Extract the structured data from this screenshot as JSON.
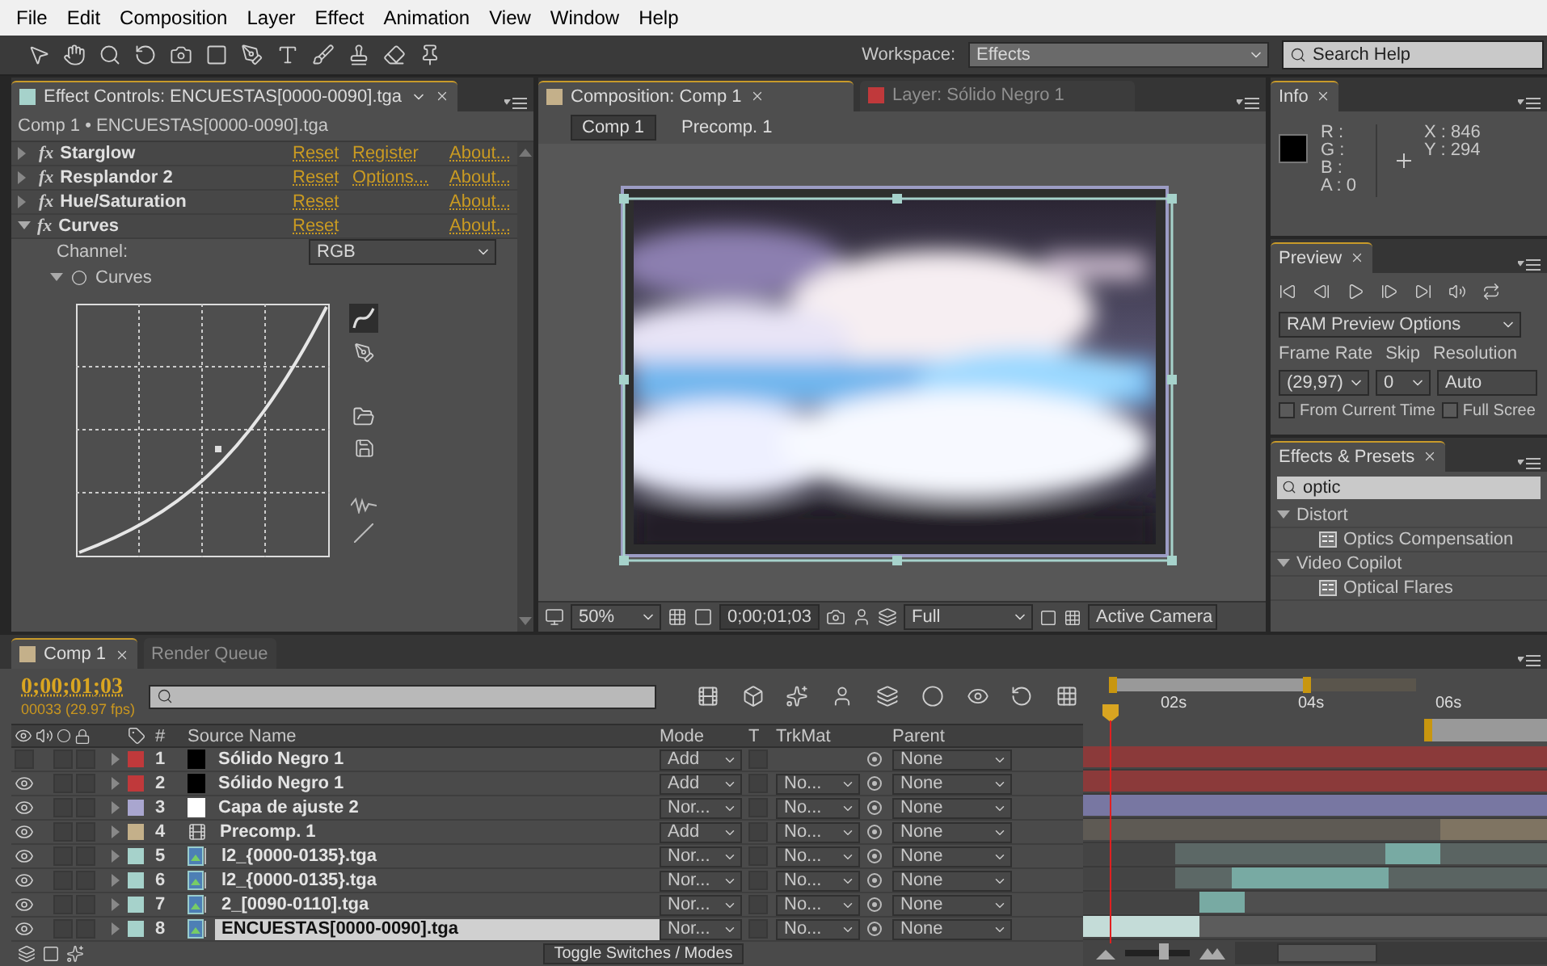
{
  "menu": [
    "File",
    "Edit",
    "Composition",
    "Layer",
    "Effect",
    "Animation",
    "View",
    "Window",
    "Help"
  ],
  "toolbar": {
    "workspace_label": "Workspace:",
    "workspace": "Effects",
    "search_placeholder": "Search Help"
  },
  "effect_controls": {
    "tab": "Effect Controls: ENCUESTAS[0000-0090].tga",
    "breadcrumb": "Comp 1 • ENCUESTAS[0000-0090].tga",
    "effects": [
      {
        "name": "Starglow",
        "fx": "fx",
        "expanded": false,
        "reset": "Reset",
        "extra": "Register",
        "about": "About..."
      },
      {
        "name": "Resplandor 2",
        "fx": "fx",
        "expanded": false,
        "reset": "Reset",
        "extra": "Options...",
        "about": "About..."
      },
      {
        "name": "Hue/Saturation",
        "fx": "fx",
        "expanded": false,
        "reset": "Reset",
        "about": "About..."
      },
      {
        "name": "Curves",
        "fx": "fx",
        "expanded": true,
        "reset": "Reset",
        "about": "About..."
      }
    ],
    "channel_label": "Channel:",
    "channel": "RGB",
    "curves_label": "Curves"
  },
  "composition": {
    "tabs": [
      {
        "label": "Composition: Comp 1",
        "selected": true
      },
      {
        "label": "Layer: Sólido Negro 1",
        "selected": false
      }
    ],
    "breadcrumbs": [
      {
        "label": "Comp 1",
        "selected": true
      },
      {
        "label": "Precomp. 1",
        "selected": false
      }
    ],
    "zoom": "50%",
    "timecode": "0;00;01;03",
    "quality": "Full",
    "camera": "Active Camera"
  },
  "info": {
    "tab": "Info",
    "swatch": {
      "color": "#000000"
    },
    "channels": [
      "R :",
      "G :",
      "B :",
      "A : 0"
    ],
    "x": "X : 846",
    "y": "Y : 294"
  },
  "preview": {
    "tab": "Preview",
    "ram_options": "RAM Preview Options",
    "frame_rate_label": "Frame Rate",
    "skip_label": "Skip",
    "resolution_label": "Resolution",
    "frame_rate": "(29,97)",
    "skip": "0",
    "resolution": "Auto",
    "options": [
      {
        "label": "From Current Time",
        "checked": false
      },
      {
        "label": "Full Scree",
        "checked": false
      }
    ]
  },
  "effects_presets": {
    "tab": "Effects & Presets",
    "search": "optic",
    "tree": [
      {
        "label": "Distort",
        "expanded": true,
        "children": [
          {
            "label": "Optics Compensation"
          }
        ]
      },
      {
        "label": "Video Copilot",
        "expanded": true,
        "children": [
          {
            "label": "Optical Flares"
          }
        ]
      }
    ]
  },
  "timeline": {
    "tabs": [
      {
        "label": "Comp 1",
        "selected": true
      },
      {
        "label": "Render Queue",
        "selected": false
      }
    ],
    "timecode": "0;00;01;03",
    "fps": "00033 (29.97 fps)",
    "columns": {
      "number": "#",
      "source": "Source Name",
      "mode": "Mode",
      "t": "T",
      "trkmat": "TrkMat",
      "parent": "Parent"
    },
    "layers": [
      {
        "number": "1",
        "name": "Sólido Negro 1",
        "color": "#c0393b",
        "visible": false,
        "source": {
          "kind": "solid",
          "color": "#000000"
        },
        "mode": "Add",
        "parent": "None",
        "selected": false
      },
      {
        "number": "2",
        "name": "Sólido Negro 1",
        "color": "#c0393b",
        "visible": true,
        "source": {
          "kind": "solid",
          "color": "#000000"
        },
        "mode": "Add",
        "trkmat": "No...",
        "parent": "None",
        "selected": false
      },
      {
        "number": "3",
        "name": "Capa de ajuste 2",
        "color": "#a9a6cf",
        "visible": true,
        "source": {
          "kind": "solid",
          "color": "#ffffff"
        },
        "mode": "Nor...",
        "trkmat": "No...",
        "parent": "None",
        "selected": false
      },
      {
        "number": "4",
        "name": "Precomp. 1",
        "color": "#c4b08a",
        "visible": true,
        "source": {
          "kind": "comp"
        },
        "mode": "Add",
        "trkmat": "No...",
        "parent": "None",
        "selected": false
      },
      {
        "number": "5",
        "name": "l2_{0000-0135}.tga",
        "color": "#a6d2cb",
        "visible": true,
        "source": {
          "kind": "footage"
        },
        "mode": "Nor...",
        "trkmat": "No...",
        "parent": "None",
        "selected": false
      },
      {
        "number": "6",
        "name": "l2_{0000-0135}.tga",
        "color": "#a6d2cb",
        "visible": true,
        "source": {
          "kind": "footage"
        },
        "mode": "Nor...",
        "trkmat": "No...",
        "parent": "None",
        "selected": false
      },
      {
        "number": "7",
        "name": "2_[0090-0110].tga",
        "color": "#a6d2cb",
        "visible": true,
        "source": {
          "kind": "footage"
        },
        "mode": "Nor...",
        "trkmat": "No...",
        "parent": "None",
        "selected": false
      },
      {
        "number": "8",
        "name": "ENCUESTAS[0000-0090].tga",
        "color": "#a6d2cb",
        "visible": true,
        "source": {
          "kind": "footage"
        },
        "mode": "Nor...",
        "trkmat": "No...",
        "parent": "None",
        "selected": true
      }
    ],
    "ruler": [
      "02s",
      "04s",
      "06s"
    ],
    "toggle": "Toggle Switches / Modes",
    "zoom_slider": {
      "level": 0.6
    }
  }
}
